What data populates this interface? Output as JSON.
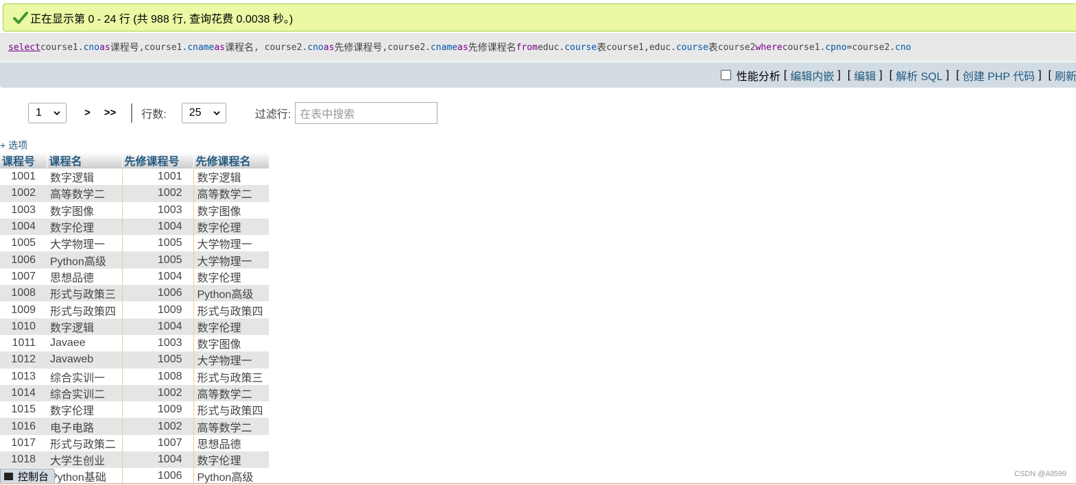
{
  "success": {
    "message": "正在显示第 0 - 24 行 (共 988 行, 查询花费 0.0038 秒。)"
  },
  "sql": {
    "t_select": "select",
    "t_1": " course1.",
    "t_2": "cno",
    "t_3": " as ",
    "t_4": "课程号",
    "t_5": ",course1.",
    "t_6": "cname",
    "t_7": " as ",
    "t_8": "课程名",
    "t_9": ", course2.",
    "t_10": "cno",
    "t_11": " as ",
    "t_12": "先修课程号",
    "t_13": ",course2.",
    "t_14": "cname",
    "t_15": " as ",
    "t_16": "先修课程名",
    "t_17": " from ",
    "t_18": "educ.",
    "t_19": "course",
    "t_20": "表",
    "t_21": " course1,educ.",
    "t_22": "course",
    "t_23": "表",
    "t_24": " course2 ",
    "t_25": "where",
    "t_26": " course1.",
    "t_27": "cpno",
    "t_28": "=course2.",
    "t_29": "cno"
  },
  "toolbar": {
    "profiling_label": "性能分析",
    "open_1": "[",
    "edit_inline": "编辑内嵌",
    "close_1": "]",
    "open_2": "[",
    "edit": "编辑",
    "close_2": "]",
    "open_3": "[",
    "explain_sql": "解析 SQL",
    "close_3": "]",
    "open_4": "[",
    "create_php": "创建 PHP 代码",
    "close_4": "]",
    "open_5": "[",
    "refresh": "刷新"
  },
  "navigation": {
    "page_select": "1",
    "next": ">",
    "last": ">>",
    "rows_label": "行数:",
    "rows_select": "25",
    "filter_label": "过滤行:",
    "filter_placeholder": "在表中搜索"
  },
  "options_link": "+ 选项",
  "table": {
    "headers": [
      "课程号",
      "课程名",
      "先修课程号",
      "先修课程名"
    ],
    "rows": [
      [
        "1001",
        "数字逻辑",
        "1001",
        "数字逻辑"
      ],
      [
        "1002",
        "高等数学二",
        "1002",
        "高等数学二"
      ],
      [
        "1003",
        "数字图像",
        "1003",
        "数字图像"
      ],
      [
        "1004",
        "数字伦理",
        "1004",
        "数字伦理"
      ],
      [
        "1005",
        "大学物理一",
        "1005",
        "大学物理一"
      ],
      [
        "1006",
        "Python高级",
        "1005",
        "大学物理一"
      ],
      [
        "1007",
        "思想品德",
        "1004",
        "数字伦理"
      ],
      [
        "1008",
        "形式与政策三",
        "1006",
        "Python高级"
      ],
      [
        "1009",
        "形式与政策四",
        "1009",
        "形式与政策四"
      ],
      [
        "1010",
        "数字逻辑",
        "1004",
        "数字伦理"
      ],
      [
        "1011",
        "Javaee",
        "1003",
        "数字图像"
      ],
      [
        "1012",
        "Javaweb",
        "1005",
        "大学物理一"
      ],
      [
        "1013",
        "综合实训一",
        "1008",
        "形式与政策三"
      ],
      [
        "1014",
        "综合实训二",
        "1002",
        "高等数学二"
      ],
      [
        "1015",
        "数字伦理",
        "1009",
        "形式与政策四"
      ],
      [
        "1016",
        "电子电路",
        "1002",
        "高等数学二"
      ],
      [
        "1017",
        "形式与政策二",
        "1007",
        "思想品德"
      ],
      [
        "1018",
        "大学生创业",
        "1004",
        "数字伦理"
      ],
      [
        "",
        "Python基础",
        "1006",
        "Python高级"
      ]
    ]
  },
  "console": {
    "label": "控制台"
  },
  "watermark": "CSDN @All599",
  "colors": {
    "success_bg": "#ebf8a4",
    "link": "#235a81",
    "sql_keyword": "#770088",
    "sql_field": "#0055aa"
  }
}
